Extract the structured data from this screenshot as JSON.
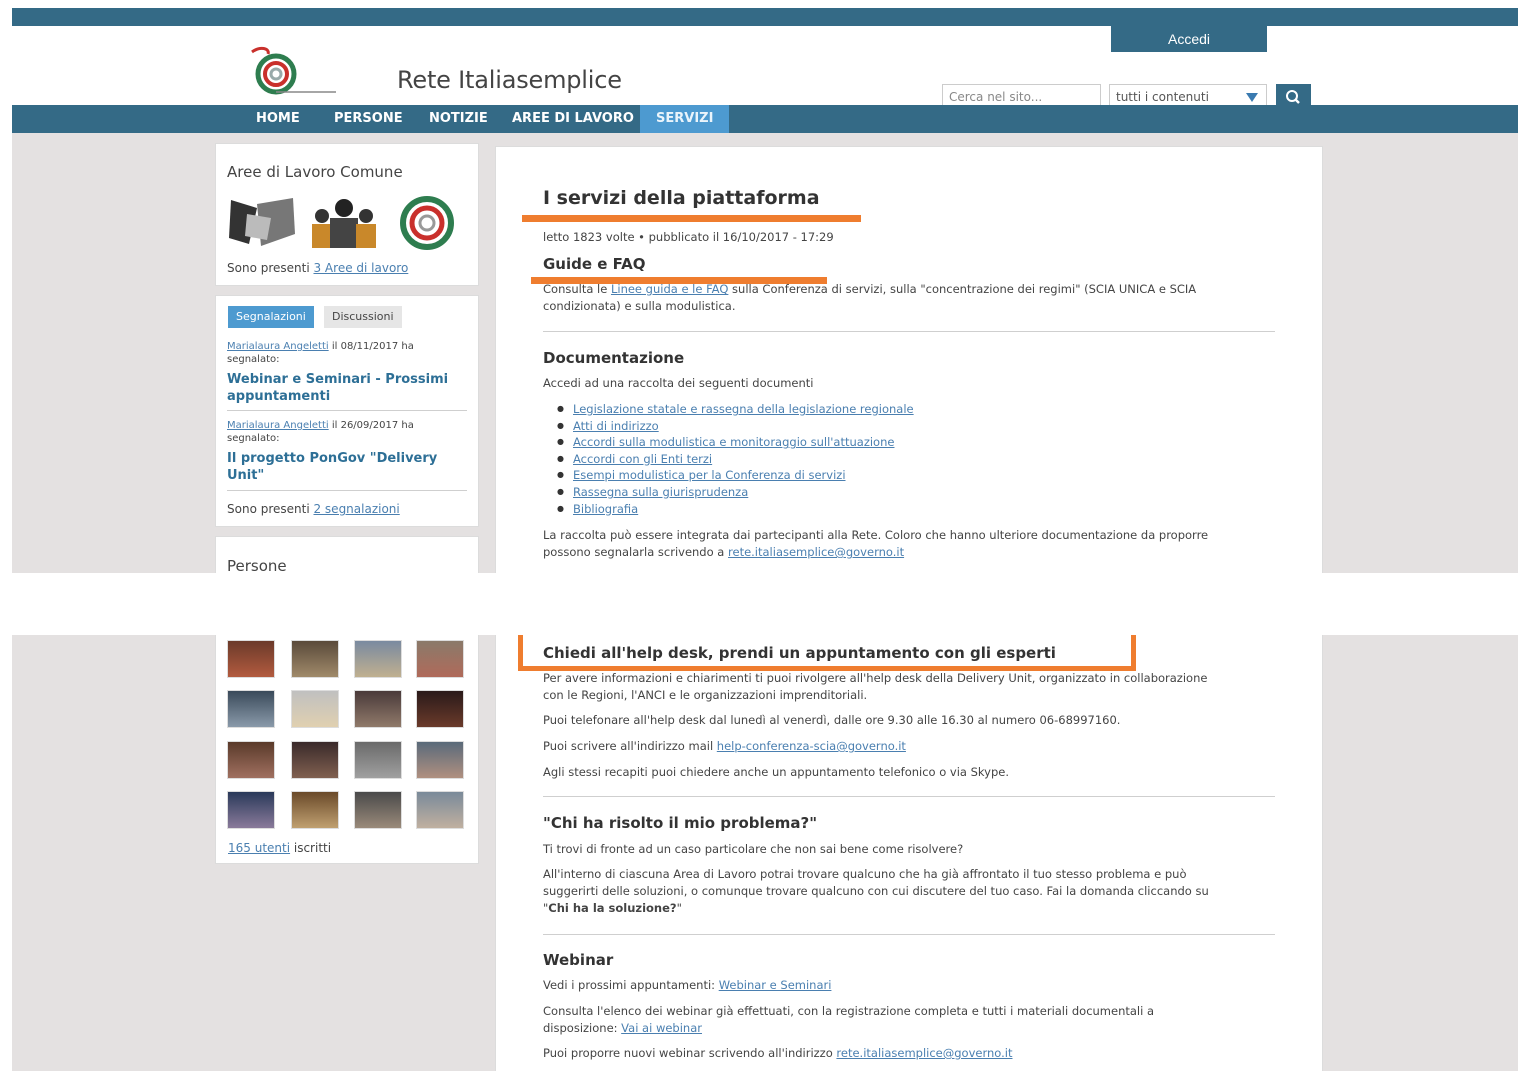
{
  "header": {
    "login_label": "Accedi",
    "site_title": "Rete Italiasemplice",
    "search_placeholder": "Cerca nel sito...",
    "search_scope": "tutti i contenuti"
  },
  "nav": [
    "HOME",
    "PERSONE",
    "NOTIZIE",
    "AREE DI LAVORO",
    "SERVIZI"
  ],
  "nav_active": "SERVIZI",
  "colors": {
    "primary": "#346a86",
    "active_tab": "#4d9ad0",
    "link": "#4a7fb0",
    "highlight": "#ef7d2f",
    "background": "#e4e1e1"
  },
  "sidebar": {
    "areas": {
      "title": "Aree di Lavoro Comune",
      "count_prefix": "Sono presenti ",
      "count_link": "3 Aree di lavoro"
    },
    "reports": {
      "tab_active": "Segnalazioni",
      "tab_other": "Discussioni",
      "items": [
        {
          "author": "Marialaura Angeletti",
          "meta": " il 08/11/2017 ha",
          "meta2": "segnalato:",
          "title": "Webinar e Seminari - Prossimi appuntamenti"
        },
        {
          "author": "Marialaura Angeletti",
          "meta": " il 26/09/2017 ha",
          "meta2": "segnalato:",
          "title": "Il progetto PonGov \"Delivery Unit\""
        }
      ],
      "count_prefix": "Sono presenti ",
      "count_link": "2 segnalazioni"
    },
    "people": {
      "title": "Persone",
      "count_link": "165 utenti",
      "count_suffix": " iscritti"
    }
  },
  "article": {
    "title": "I servizi della piattaforma",
    "meta": "letto 1823 volte • pubblicato il 16/10/2017 - 17:29",
    "guide": {
      "heading": "Guide e FAQ",
      "pre": "Consulta le ",
      "link": "Linee guida e le FAQ",
      "post": " sulla Conferenza di servizi, sulla \"concentrazione dei regimi\" (SCIA UNICA e SCIA",
      "line2": "condizionata) e sulla modulistica."
    },
    "docs": {
      "heading": "Documentazione",
      "intro": "Accedi ad una raccolta dei seguenti documenti",
      "items": [
        "Legislazione statale e rassegna della legislazione regionale",
        "Atti di indirizzo",
        "Accordi sulla modulistica e monitoraggio sull'attuazione",
        "Accordi con gli Enti terzi",
        "Esempi modulistica per la Conferenza di servizi",
        "Rassegna sulla giurisprudenza",
        "Bibliografia"
      ],
      "note1": "La raccolta può essere integrata dai partecipanti alla Rete. Coloro che hanno ulteriore documentazione da proporre",
      "note2_pre": "possono segnalarla scrivendo a ",
      "note2_link": "rete.italiasemplice@governo.it"
    },
    "helpdesk": {
      "heading": "Chiedi all'help desk, prendi un appuntamento con gli esperti",
      "p1a": "Per avere informazioni e chiarimenti ti puoi rivolgere all'help desk della Delivery Unit, organizzato in collaborazione",
      "p1b": "con le Regioni, l'ANCI e le organizzazioni imprenditoriali.",
      "p2": "Puoi telefonare all'help desk dal lunedì al venerdì, dalle ore 9.30 alle 16.30 al numero 06-68997160.",
      "p3_pre": "Puoi scrivere all'indirizzo mail ",
      "p3_link": "help-conferenza-scia@governo.it",
      "p4": "Agli stessi recapiti puoi chiedere anche un appuntamento telefonico o via Skype."
    },
    "solved": {
      "heading": "\"Chi ha risolto il mio problema?\"",
      "p1": "Ti trovi di fronte ad un caso particolare che non sai bene come risolvere?",
      "p2a": "All'interno di ciascuna Area di Lavoro potrai trovare qualcuno che ha già affrontato il tuo stesso problema e può",
      "p2b": "suggerirti delle soluzioni, o comunque trovare qualcuno con cui discutere del tuo caso. Fai la domanda cliccando su",
      "p2c_q1": "\"",
      "p2c_bold": "Chi ha la soluzione?",
      "p2c_q2": "\""
    },
    "webinar": {
      "heading": "Webinar",
      "p1_pre": "Vedi i prossimi appuntamenti: ",
      "p1_link": "Webinar e Seminari",
      "p2a": "Consulta l'elenco dei webinar già effettuati, con la registrazione completa e tutti i materiali documentali a",
      "p2b_pre": "disposizione: ",
      "p2b_link": "Vai ai webinar",
      "p3_pre": "Puoi proporre nuovi webinar scrivendo all'indirizzo ",
      "p3_link": "rete.italiasemplice@governo.it"
    }
  }
}
